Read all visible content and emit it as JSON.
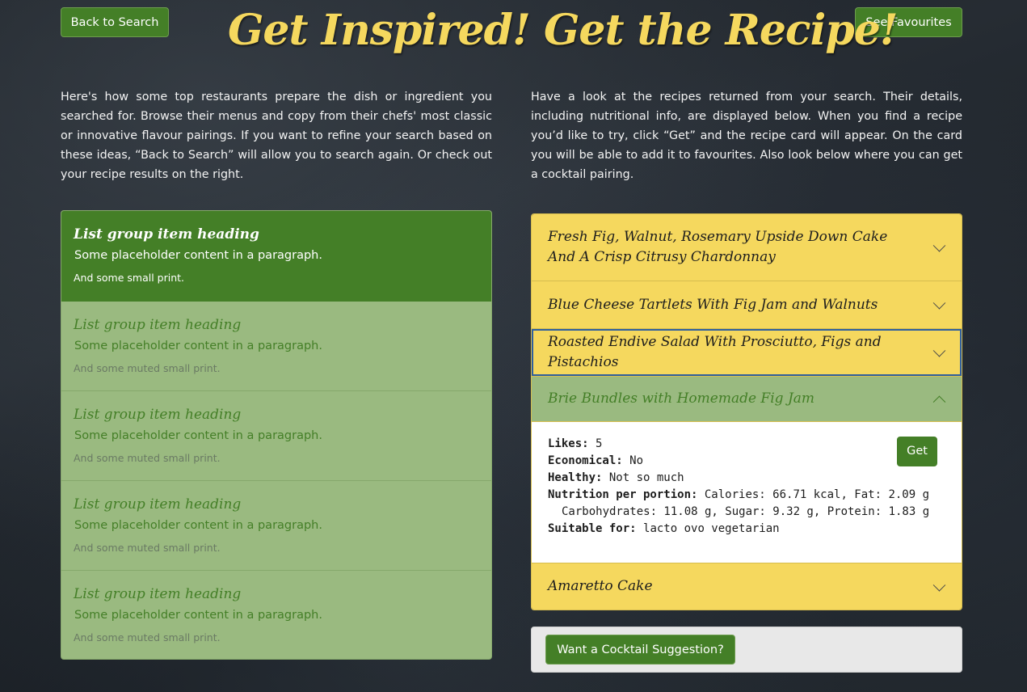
{
  "header": {
    "back_label": "Back to Search",
    "fav_label": "See Favourites",
    "title_left": "Get Inspired!",
    "title_right": "Get the Recipe!"
  },
  "intro": {
    "left": "Here's how some top restaurants prepare the dish or ingredient you searched for. Browse their menus and copy from their chefs' most classic or innovative flavour pairings. If you want to refine your search based on these ideas, “Back to Search” will allow you to search again. Or check out your recipe results on the right.",
    "right": "Have a look at the recipes returned from your search. Their details, including nutritional info, are displayed below. When you find a recipe you’d like to try, click “Get” and the recipe card will appear. On the card you will be able to add it to favourites. Also look below where you can get a cocktail pairing."
  },
  "list_group": {
    "items": [
      {
        "heading": "List group item heading",
        "text": "Some placeholder content in a paragraph.",
        "small": "And some small print."
      },
      {
        "heading": "List group item heading",
        "text": "Some placeholder content in a paragraph.",
        "small": "And some muted small print."
      },
      {
        "heading": "List group item heading",
        "text": "Some placeholder content in a paragraph.",
        "small": "And some muted small print."
      },
      {
        "heading": "List group item heading",
        "text": "Some placeholder content in a paragraph.",
        "small": "And some muted small print."
      },
      {
        "heading": "List group item heading",
        "text": "Some placeholder content in a paragraph.",
        "small": "And some muted small print."
      }
    ]
  },
  "accordion": {
    "items": [
      {
        "title": "Fresh Fig, Walnut, Rosemary Upside Down Cake And A Crisp Citrusy Chardonnay"
      },
      {
        "title": "Blue Cheese Tartlets With Fig Jam and Walnuts"
      },
      {
        "title": "Roasted Endive Salad With Prosciutto, Figs and Pistachios"
      },
      {
        "title": "Brie Bundles with Homemade Fig Jam"
      },
      {
        "title": "Amaretto Cake"
      }
    ],
    "open_item": {
      "likes_label": "Likes:",
      "likes": "5",
      "economical_label": "Economical:",
      "economical": "No",
      "healthy_label": "Healthy:",
      "healthy": "Not so much",
      "nutrition_label": "Nutrition per portion:",
      "nutrition_line1": "Calories: 66.71 kcal, Fat: 2.09 g",
      "nutrition_line2": "Carbohydrates: 11.08 g, Sugar: 9.32 g, Protein: 1.83 g",
      "suitable_label": "Suitable for:",
      "suitable": "lacto ovo vegetarian",
      "get_label": "Get"
    }
  },
  "cocktail": {
    "button_label": "Want a Cocktail Suggestion?"
  },
  "colors": {
    "primary_green": "#447f27",
    "accent_yellow": "#f5d85e",
    "muted_green": "#9aba80"
  }
}
